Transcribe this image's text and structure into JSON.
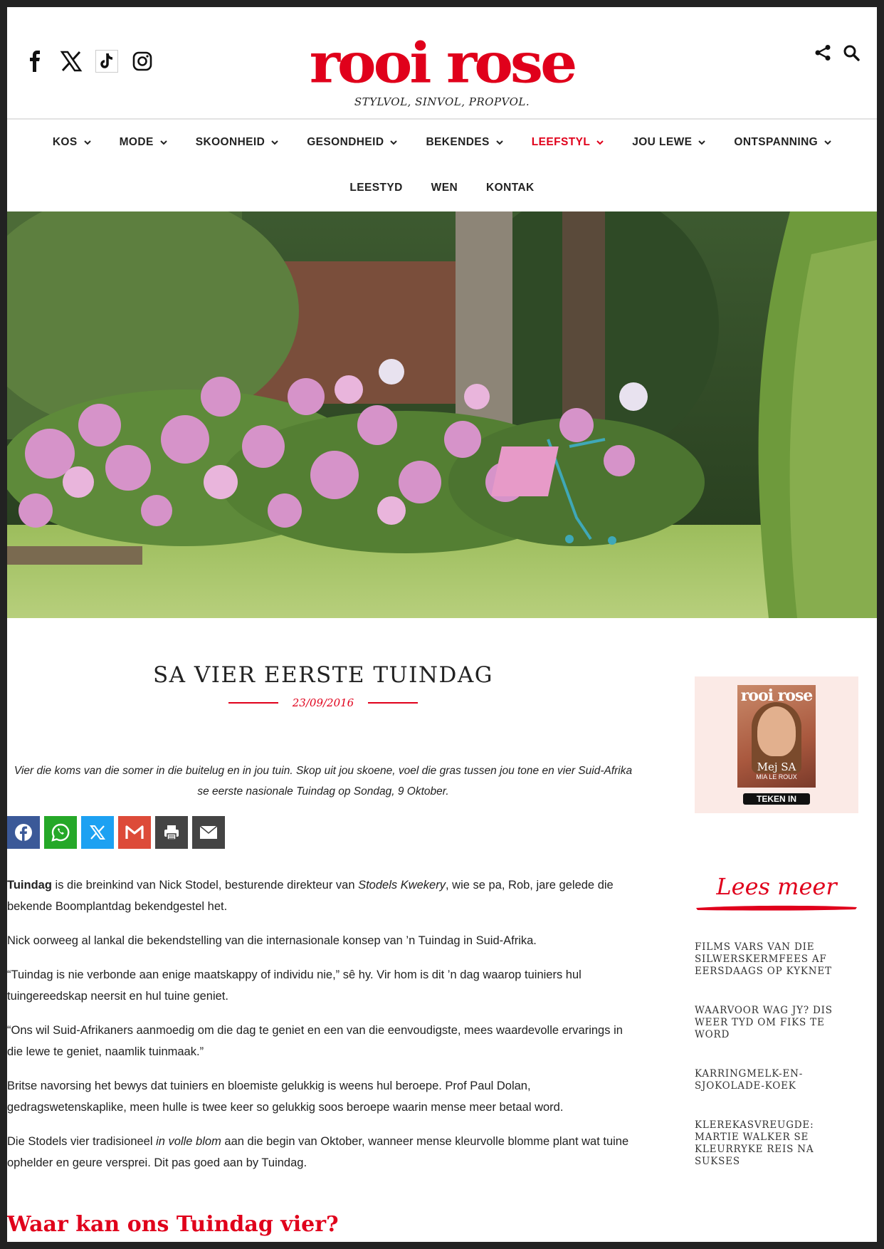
{
  "brand": {
    "logo": "rooi rose",
    "tagline": "STYLVOL, SINVOL, PROPVOL."
  },
  "social_icons": [
    "facebook-icon",
    "x-icon",
    "tiktok-icon",
    "instagram-icon"
  ],
  "header_tools": [
    "share-icon",
    "search-icon"
  ],
  "nav": {
    "row1": [
      {
        "label": "KOS",
        "dropdown": true
      },
      {
        "label": "MODE",
        "dropdown": true
      },
      {
        "label": "SKOONHEID",
        "dropdown": true
      },
      {
        "label": "GESONDHEID",
        "dropdown": true
      },
      {
        "label": "BEKENDES",
        "dropdown": true
      },
      {
        "label": "LEEFSTYL",
        "dropdown": true,
        "active": true
      },
      {
        "label": "JOU LEWE",
        "dropdown": true
      },
      {
        "label": "ONTSPANNING",
        "dropdown": true
      }
    ],
    "row2": [
      {
        "label": "LEESTYD"
      },
      {
        "label": "WEN"
      },
      {
        "label": "KONTAK"
      }
    ]
  },
  "article": {
    "title": "SA VIER EERSTE TUINDAG",
    "date": "23/09/2016",
    "lead": "Vier die koms van die somer in die buitelug en in jou tuin. Skop uit jou skoene, voel die gras tussen jou tone en vier Suid-Afrika se eerste nasionale Tuindag op Sondag, 9 Oktober.",
    "share_buttons": [
      "facebook",
      "whatsapp",
      "x",
      "gmail",
      "print",
      "email"
    ],
    "p1_bold": "Tuindag",
    "p1_a": " is die breinkind van Nick Stodel, besturende direkteur van ",
    "p1_italic": "Stodels Kwekery",
    "p1_b": ", wie se pa, Rob, jare gelede die bekende Boomplantdag bekendgestel het.",
    "p2": "Nick oorweeg al lankal die bekendstelling van die internasionale konsep van ’n Tuindag in Suid-Afrika.",
    "p3": "“Tuindag is nie verbonde aan enige maatskappy of individu nie,” sê hy. Vir hom is dit ’n dag waarop tuiniers hul tuingereedskap neersit en hul tuine geniet.",
    "p4": "“Ons wil Suid-Afrikaners aanmoedig om die dag te geniet en een van die eenvoudigste, mees waardevolle ervarings in die lewe te geniet, naamlik tuinmaak.”",
    "p5": "Britse navorsing het bewys dat tuiniers en bloemiste gelukkig is weens hul beroepe. Prof Paul Dolan, gedragswetenskaplike, meen hulle is twee keer so gelukkig soos beroepe waarin mense meer betaal word.",
    "p6_a": "Die Stodels vier tradisioneel ",
    "p6_italic": "in volle blom",
    "p6_b": " aan die begin van Oktober, wanneer mense kleurvolle blomme plant wat tuine ophelder en geure versprei. Dit pas goed aan by Tuindag.",
    "subheading": "Waar kan ons Tuindag vier?"
  },
  "sidebar": {
    "ad": {
      "mag_logo": "rooi rose",
      "mag_cover_name": "Mej SA",
      "mag_cover_sub": "MIA LE ROUX",
      "cta": "TEKEN IN"
    },
    "more_title": "Lees meer",
    "more_items": [
      "FILMS VARS VAN DIE SILWERSKERMFEES AF EERSDAAGS OP KYKNET",
      "WAARVOOR WAG JY? DIS WEER TYD OM FIKS TE WORD",
      "KARRINGMELK-EN-SJOKOLADE-KOEK",
      "KLEREKASVREUGDE: MARTIE WALKER SE KLEURRYKE REIS NA SUKSES"
    ]
  },
  "colors": {
    "brand_red": "#e0001b",
    "facebook": "#3b5998",
    "whatsapp": "#25a828",
    "x": "#1da1f2",
    "gmail": "#dd4b39",
    "print": "#444444",
    "email": "#444444"
  }
}
